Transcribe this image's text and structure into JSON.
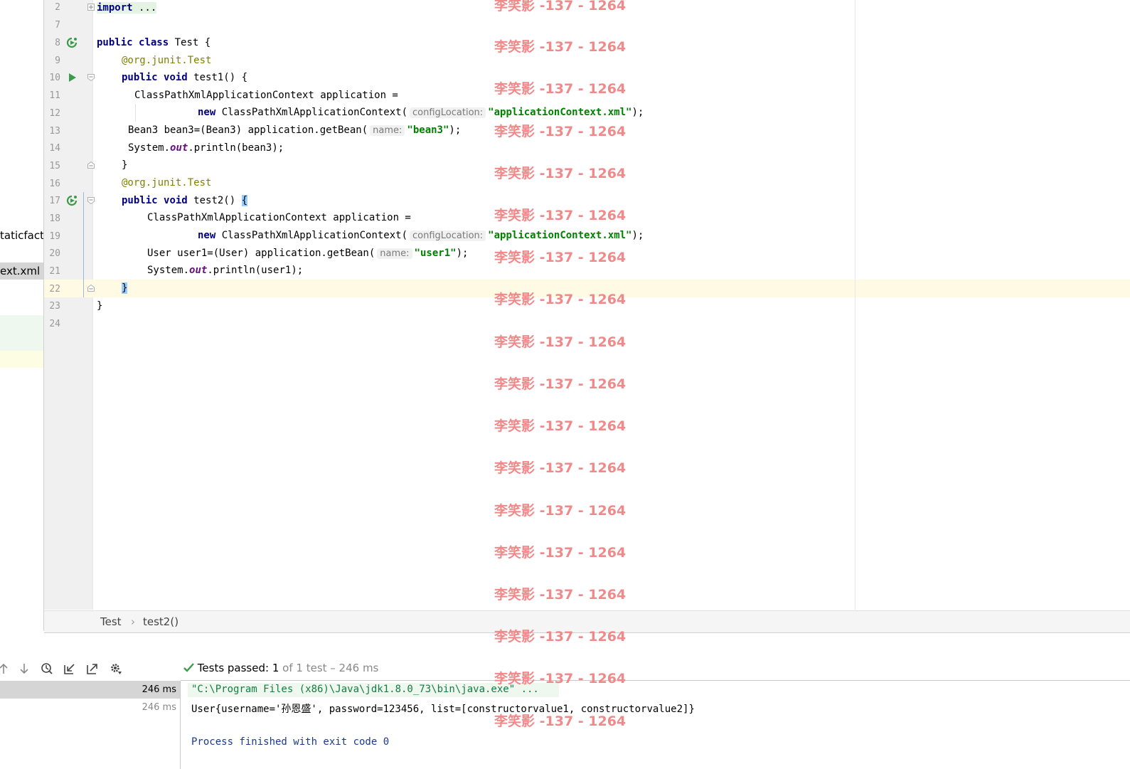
{
  "project_fragments": {
    "staticfactory": "taticfacto",
    "xml_file": "ext.xml"
  },
  "editor": {
    "line_numbers": [
      "2",
      "7",
      "8",
      "9",
      "10",
      "11",
      "12",
      "13",
      "14",
      "15",
      "16",
      "17",
      "18",
      "19",
      "20",
      "21",
      "22",
      "23",
      "24"
    ],
    "code": {
      "l2_kw": "import",
      "l2_fold": " ...",
      "l8_a": "public",
      "l8_b": "class",
      "l8_c": " Test {",
      "l9_ann": "@org.junit.",
      "l9_test": "Test",
      "l10_a": "public",
      "l10_b": "void",
      "l10_c": " test1() {",
      "l11": "ClassPathXmlApplicationContext application =",
      "l12_new": "new",
      "l12_cls": " ClassPathXmlApplicationContext(",
      "l12_hint": "configLocation:",
      "l12_str": "\"applicationContext.xml\"",
      "l12_end": ");",
      "l13_a": "Bean3 bean3=(Bean3) application.getBean(",
      "l13_hint": "name:",
      "l13_str": "\"bean3\"",
      "l13_end": ");",
      "l14_a": "System.",
      "l14_out": "out",
      "l14_b": ".println(bean3);",
      "l15": "}",
      "l16_ann": "@org.junit.",
      "l16_test": "Test",
      "l17_a": "public",
      "l17_b": "void",
      "l17_c": " test2() ",
      "l17_brace": "{",
      "l18": "ClassPathXmlApplicationContext application =",
      "l19_new": "new",
      "l19_cls": " ClassPathXmlApplicationContext(",
      "l19_hint": "configLocation:",
      "l19_str": "\"applicationContext.xml\"",
      "l19_end": ");",
      "l20_a": "User user1=(User) application.getBean(",
      "l20_hint": "name:",
      "l20_str": "\"user1\"",
      "l20_end": ");",
      "l21_a": "System.",
      "l21_out": "out",
      "l21_b": ".println(user1);",
      "l22": "}",
      "l23": "}"
    }
  },
  "breadcrumb": {
    "class": "Test",
    "separator": "›",
    "method": "test2()"
  },
  "run_panel": {
    "status_label": "Tests passed:",
    "status_count": "1",
    "status_rest": "of 1 test – 246 ms",
    "tree_durations": [
      "246 ms",
      "246 ms"
    ],
    "console": {
      "command": "\"C:\\Program Files (x86)\\Java\\jdk1.8.0_73\\bin\\java.exe\" ...",
      "output": "User{username='孙恩盛', password=123456, list=[constructorvalue1, constructorvalue2]}",
      "exit": "Process finished with exit code 0"
    }
  },
  "watermark": {
    "text": "李笑影 -137 - 1264",
    "color": "#f08a8a"
  },
  "colors": {
    "keyword": "#000080",
    "string": "#008000",
    "annotation": "#808000",
    "field": "#660e7a",
    "current_line": "#fffae3",
    "run_green": "#3a9b4a"
  }
}
